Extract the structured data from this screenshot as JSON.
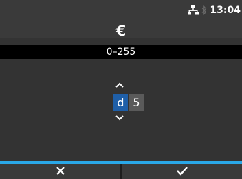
{
  "status_bar": {
    "time": "13:04",
    "network_icon": "network-icon",
    "bluetooth_icon": "bluetooth-icon"
  },
  "header": {
    "title": "€"
  },
  "range": {
    "label": "0–255"
  },
  "editor": {
    "digits": [
      "d",
      "5"
    ],
    "active_index": 0,
    "up_icon": "chevron-up-icon",
    "down_icon": "chevron-down-icon"
  },
  "footer": {
    "cancel_icon": "close-icon",
    "confirm_icon": "check-icon"
  },
  "colors": {
    "accent": "#2aa8e8",
    "selected_cell": "#1f5fa8",
    "background": "#333333"
  }
}
